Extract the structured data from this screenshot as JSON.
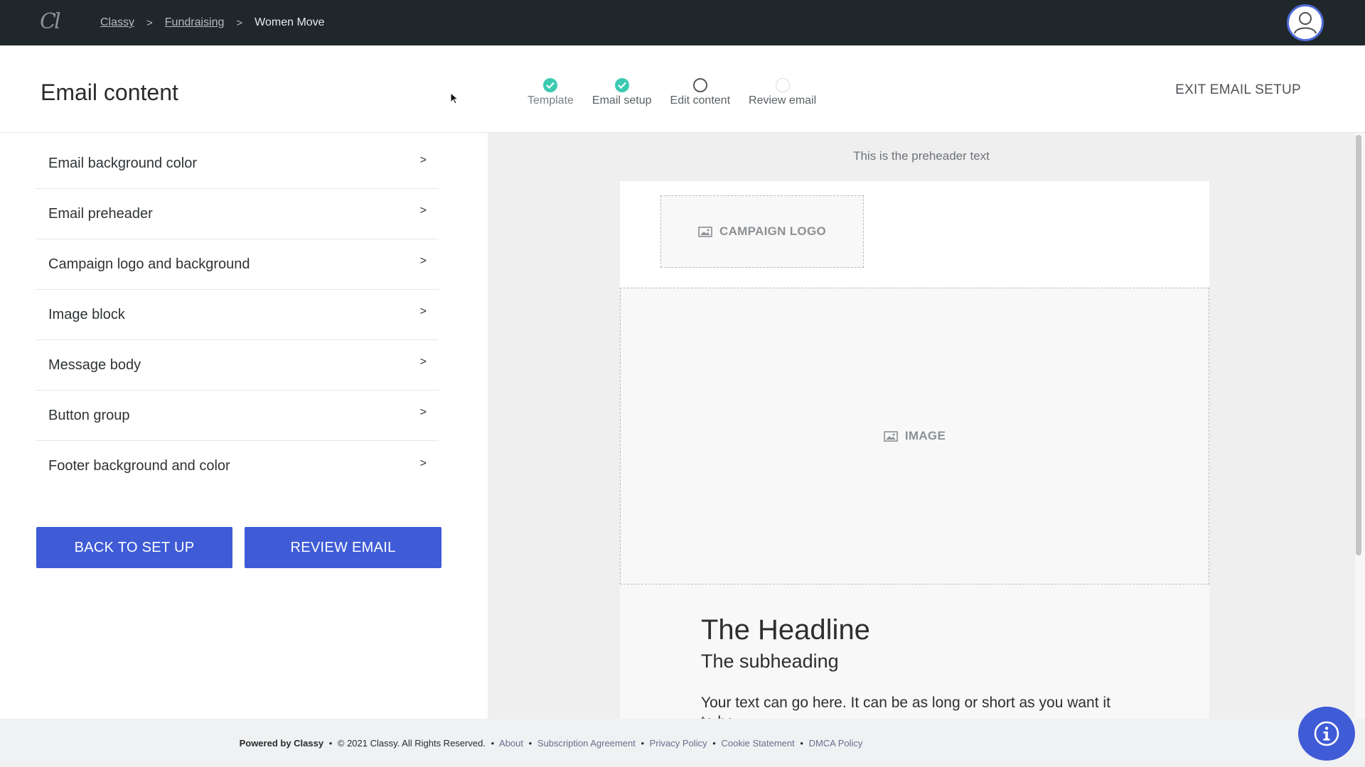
{
  "nav": {
    "logo_text": "Cl",
    "breadcrumb": [
      {
        "label": "Classy"
      },
      {
        "label": "Fundraising"
      }
    ],
    "breadcrumb_current": "Women Move",
    "separator": ">"
  },
  "header": {
    "title": "Email content",
    "exit_label": "EXIT EMAIL SETUP",
    "steps": [
      {
        "label": "Template",
        "status": "done"
      },
      {
        "label": "Email setup",
        "status": "done"
      },
      {
        "label": "Edit content",
        "status": "current"
      },
      {
        "label": "Review email",
        "status": "todo"
      }
    ]
  },
  "sidebar": {
    "items": [
      {
        "label": "Email background color"
      },
      {
        "label": "Email preheader"
      },
      {
        "label": "Campaign logo and background"
      },
      {
        "label": "Image block"
      },
      {
        "label": "Message body"
      },
      {
        "label": "Button group"
      },
      {
        "label": "Footer background and color"
      }
    ],
    "chevron": ">",
    "back_label": "BACK TO SET UP",
    "review_label": "REVIEW EMAIL"
  },
  "preview": {
    "preheader": "This is the preheader text",
    "logo_placeholder": "CAMPAIGN LOGO",
    "image_placeholder": "IMAGE",
    "headline": "The Headline",
    "subheading": "The subheading",
    "body": "Your text can go here. It can be as long or short as you want it to be."
  },
  "footer": {
    "powered_by": "Powered by Classy",
    "copyright": "© 2021 Classy. All Rights Reserved.",
    "bullet": "•",
    "links": [
      "About",
      "Subscription Agreement",
      "Privacy Policy",
      "Cookie Statement",
      "DMCA Policy"
    ]
  },
  "colors": {
    "nav_bg": "#1f272b",
    "accent": "#3f5bd6",
    "step_done": "#3ccab2",
    "preview_bg": "#efeff0"
  }
}
